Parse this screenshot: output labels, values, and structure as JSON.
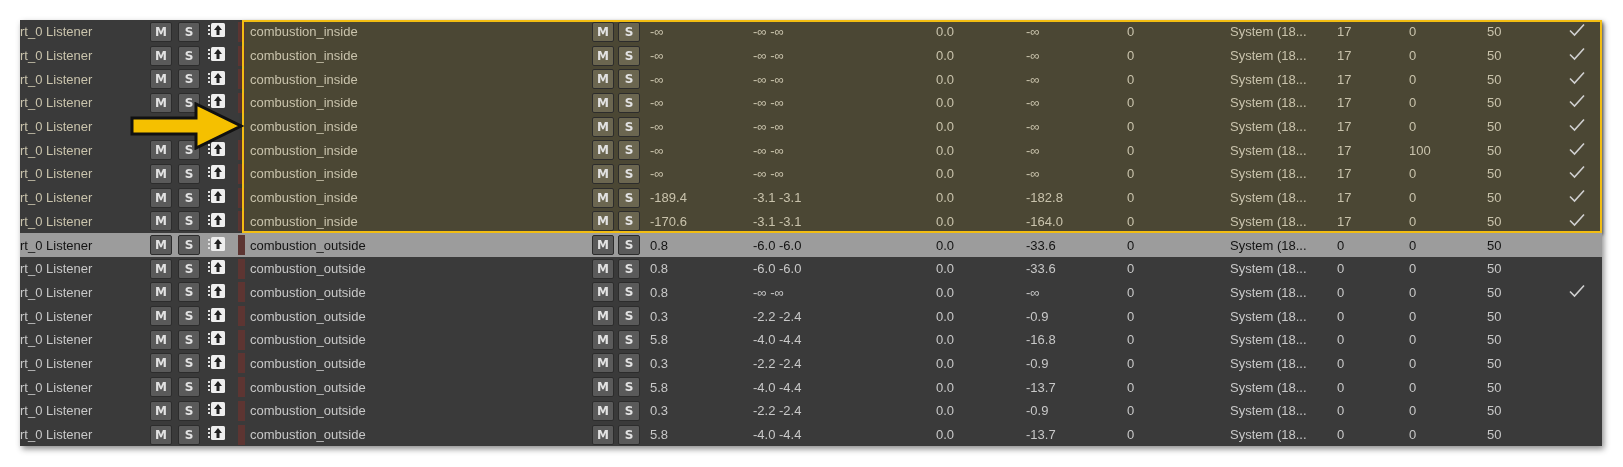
{
  "groups": [
    {
      "highlighted": true,
      "rows": [
        {
          "listener": "rt_0 Listener",
          "mute": "M",
          "solo": "S",
          "name": "combustion_inside",
          "mute2": "M",
          "solo2": "S",
          "values": [
            "-∞",
            "-∞ -∞",
            "0.0",
            "-∞",
            "0",
            "System (18...",
            "17",
            "0",
            "50"
          ],
          "checked": true,
          "selected": false
        },
        {
          "listener": "rt_0 Listener",
          "mute": "M",
          "solo": "S",
          "name": "combustion_inside",
          "mute2": "M",
          "solo2": "S",
          "values": [
            "-∞",
            "-∞ -∞",
            "0.0",
            "-∞",
            "0",
            "System (18...",
            "17",
            "0",
            "50"
          ],
          "checked": true,
          "selected": false
        },
        {
          "listener": "rt_0 Listener",
          "mute": "M",
          "solo": "S",
          "name": "combustion_inside",
          "mute2": "M",
          "solo2": "S",
          "values": [
            "-∞",
            "-∞ -∞",
            "0.0",
            "-∞",
            "0",
            "System (18...",
            "17",
            "0",
            "50"
          ],
          "checked": true,
          "selected": false
        },
        {
          "listener": "rt_0 Listener",
          "mute": "M",
          "solo": "S",
          "name": "combustion_inside",
          "mute2": "M",
          "solo2": "S",
          "values": [
            "-∞",
            "-∞ -∞",
            "0.0",
            "-∞",
            "0",
            "System (18...",
            "17",
            "0",
            "50"
          ],
          "checked": true,
          "selected": false
        },
        {
          "kind": "covered",
          "listener": "rt_0 Listener",
          "name": "combustion_inside",
          "mute2": "M",
          "solo2": "S",
          "values": [
            "-∞",
            "-∞ -∞",
            "0.0",
            "-∞",
            "0",
            "System (18...",
            "17",
            "0",
            "50"
          ],
          "checked": true,
          "selected": false
        },
        {
          "listener": "rt_0 Listener",
          "mute": "M",
          "solo": "S",
          "name": "combustion_inside",
          "mute2": "M",
          "solo2": "S",
          "values": [
            "-∞",
            "-∞ -∞",
            "0.0",
            "-∞",
            "0",
            "System (18...",
            "17",
            "100",
            "50"
          ],
          "checked": true,
          "selected": false
        },
        {
          "listener": "rt_0 Listener",
          "mute": "M",
          "solo": "S",
          "name": "combustion_inside",
          "mute2": "M",
          "solo2": "S",
          "values": [
            "-∞",
            "-∞ -∞",
            "0.0",
            "-∞",
            "0",
            "System (18...",
            "17",
            "0",
            "50"
          ],
          "checked": true,
          "selected": false
        },
        {
          "listener": "rt_0 Listener",
          "mute": "M",
          "solo": "S",
          "name": "combustion_inside",
          "mute2": "M",
          "solo2": "S",
          "values": [
            "-189.4",
            "-3.1 -3.1",
            "0.0",
            "-182.8",
            "0",
            "System (18...",
            "17",
            "0",
            "50"
          ],
          "checked": true,
          "selected": false
        },
        {
          "listener": "rt_0 Listener",
          "mute": "M",
          "solo": "S",
          "name": "combustion_inside",
          "mute2": "M",
          "solo2": "S",
          "values": [
            "-170.6",
            "-3.1 -3.1",
            "0.0",
            "-164.0",
            "0",
            "System (18...",
            "17",
            "0",
            "50"
          ],
          "checked": true,
          "selected": false
        }
      ]
    },
    {
      "highlighted": false,
      "rows": [
        {
          "listener": "rt_0 Listener",
          "mute": "M",
          "solo": "S",
          "name": "combustion_outside",
          "mute2": "M",
          "solo2": "S",
          "values": [
            "0.8",
            "-6.0 -6.0",
            "0.0",
            "-33.6",
            "0",
            "System (18...",
            "0",
            "0",
            "50"
          ],
          "checked": false,
          "selected": true
        },
        {
          "listener": "rt_0 Listener",
          "mute": "M",
          "solo": "S",
          "name": "combustion_outside",
          "mute2": "M",
          "solo2": "S",
          "values": [
            "0.8",
            "-6.0 -6.0",
            "0.0",
            "-33.6",
            "0",
            "System (18...",
            "0",
            "0",
            "50"
          ],
          "checked": false,
          "selected": false
        },
        {
          "listener": "rt_0 Listener",
          "mute": "M",
          "solo": "S",
          "name": "combustion_outside",
          "mute2": "M",
          "solo2": "S",
          "values": [
            "0.8",
            "-∞ -∞",
            "0.0",
            "-∞",
            "0",
            "System (18...",
            "0",
            "0",
            "50"
          ],
          "checked": true,
          "selected": false
        },
        {
          "listener": "rt_0 Listener",
          "mute": "M",
          "solo": "S",
          "name": "combustion_outside",
          "mute2": "M",
          "solo2": "S",
          "values": [
            "0.3",
            "-2.2 -2.4",
            "0.0",
            "-0.9",
            "0",
            "System (18...",
            "0",
            "0",
            "50"
          ],
          "checked": false,
          "selected": false
        },
        {
          "listener": "rt_0 Listener",
          "mute": "M",
          "solo": "S",
          "name": "combustion_outside",
          "mute2": "M",
          "solo2": "S",
          "values": [
            "5.8",
            "-4.0 -4.4",
            "0.0",
            "-16.8",
            "0",
            "System (18...",
            "0",
            "0",
            "50"
          ],
          "checked": false,
          "selected": false
        },
        {
          "listener": "rt_0 Listener",
          "mute": "M",
          "solo": "S",
          "name": "combustion_outside",
          "mute2": "M",
          "solo2": "S",
          "values": [
            "0.3",
            "-2.2 -2.4",
            "0.0",
            "-0.9",
            "0",
            "System (18...",
            "0",
            "0",
            "50"
          ],
          "checked": false,
          "selected": false
        },
        {
          "listener": "rt_0 Listener",
          "mute": "M",
          "solo": "S",
          "name": "combustion_outside",
          "mute2": "M",
          "solo2": "S",
          "values": [
            "5.8",
            "-4.0 -4.4",
            "0.0",
            "-13.7",
            "0",
            "System (18...",
            "0",
            "0",
            "50"
          ],
          "checked": false,
          "selected": false
        },
        {
          "listener": "rt_0 Listener",
          "mute": "M",
          "solo": "S",
          "name": "combustion_outside",
          "mute2": "M",
          "solo2": "S",
          "values": [
            "0.3",
            "-2.2 -2.4",
            "0.0",
            "-0.9",
            "0",
            "System (18...",
            "0",
            "0",
            "50"
          ],
          "checked": false,
          "selected": false
        },
        {
          "listener": "rt_0 Listener",
          "mute": "M",
          "solo": "S",
          "name": "combustion_outside",
          "mute2": "M",
          "solo2": "S",
          "values": [
            "5.8",
            "-4.0 -4.4",
            "0.0",
            "-13.7",
            "0",
            "System (18...",
            "0",
            "0",
            "50"
          ],
          "checked": false,
          "selected": false
        }
      ]
    }
  ]
}
